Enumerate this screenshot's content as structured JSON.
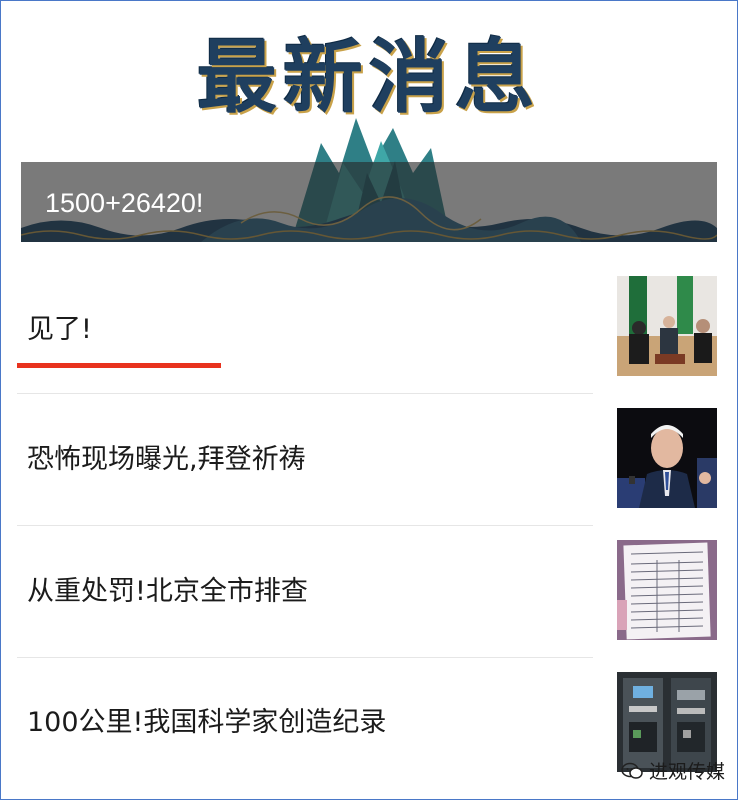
{
  "banner": {
    "title": "最新消息",
    "caption": "1500+26420!"
  },
  "news": [
    {
      "title": "见了!",
      "active": true,
      "thumb_icon": "meeting-photo"
    },
    {
      "title": "恐怖现场曝光,拜登祈祷",
      "active": false,
      "thumb_icon": "speaker-photo"
    },
    {
      "title": "从重处罚!北京全市排查",
      "active": false,
      "thumb_icon": "document-photo"
    },
    {
      "title": "100公里!我国科学家创造纪录",
      "active": false,
      "thumb_icon": "lab-photo"
    }
  ],
  "watermark": "进观传媒",
  "colors": {
    "accent": "#e8321e",
    "frame": "#4a78c8",
    "divider": "#e6e6e6"
  }
}
